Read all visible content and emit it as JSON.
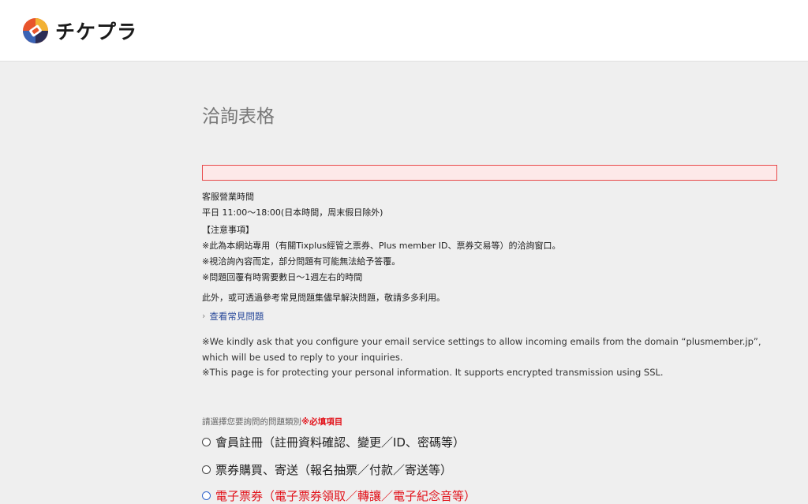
{
  "header": {
    "logo_text": "チケプラ"
  },
  "page": {
    "title": "洽詢表格",
    "info": {
      "hours_label": "客服營業時間",
      "hours_value": "平日 11:00～18:00(日本時間，周末假日除外)",
      "notice_title": "【注意事項】",
      "notice_1": "※此為本網站專用（有關Tixplus經管之票券、Plus member ID、票券交易等）的洽詢窗口。",
      "notice_2": "※視洽詢內容而定，部分問題有可能無法給予答覆。",
      "notice_3": "※問題回覆有時需要數日～1週左右的時間",
      "faq_hint": "此外，或可透過參考常見問題集儘早解決問題，敬請多多利用。",
      "faq_link": "查看常見問題",
      "en_1": "※We kindly ask that you configure your email service settings to allow incoming emails from the domain “plusmember.jp”, which will be used to reply to your inquiries.",
      "en_2": "※This page is for protecting your personal information. It supports encrypted transmission using SSL."
    },
    "category": {
      "label": "請選擇您要詢問的問題類別",
      "required": "※必填項目",
      "options": [
        "會員註冊（註冊資料確認、變更／ID、密碼等）",
        "票券購買、寄送（報名抽票／付款／寄送等）",
        "電子票券（電子票券領取／轉讓／電子紀念音等）"
      ]
    }
  },
  "colors": {
    "accent_red": "#e2151d",
    "link_blue": "#2b4b9b",
    "error_border": "#e8494a",
    "error_bg": "#fde9e9"
  }
}
